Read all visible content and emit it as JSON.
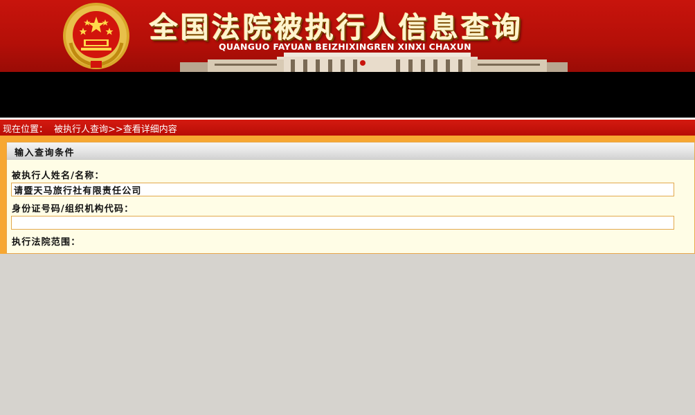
{
  "header": {
    "title": "全国法院被执行人信息查询",
    "pinyin": "QUANGUO  FAYUAN  BEIZHIXINGREN  XINXI  CHAXUN",
    "emblem_icon": "national-emblem-icon",
    "colors": {
      "banner_red": "#c8140c",
      "title_gold": "#fff4cf"
    }
  },
  "breadcrumb": {
    "label": "现在位置：",
    "path": "被执行人查询>>查看详细内容"
  },
  "panel": {
    "title": "输入查询条件",
    "fields": {
      "name_label": "被执行人姓名/名称：",
      "name_value": "请暨天马旅行社有限责任公司",
      "id_label": "身份证号码/组织机构代码：",
      "id_value": "",
      "court_label": "执行法院范围："
    }
  },
  "colors": {
    "page_bg": "#d6d3ce",
    "frame_orange": "#f7a732",
    "panel_bg": "#fffde6",
    "input_border": "#e2a84c"
  }
}
